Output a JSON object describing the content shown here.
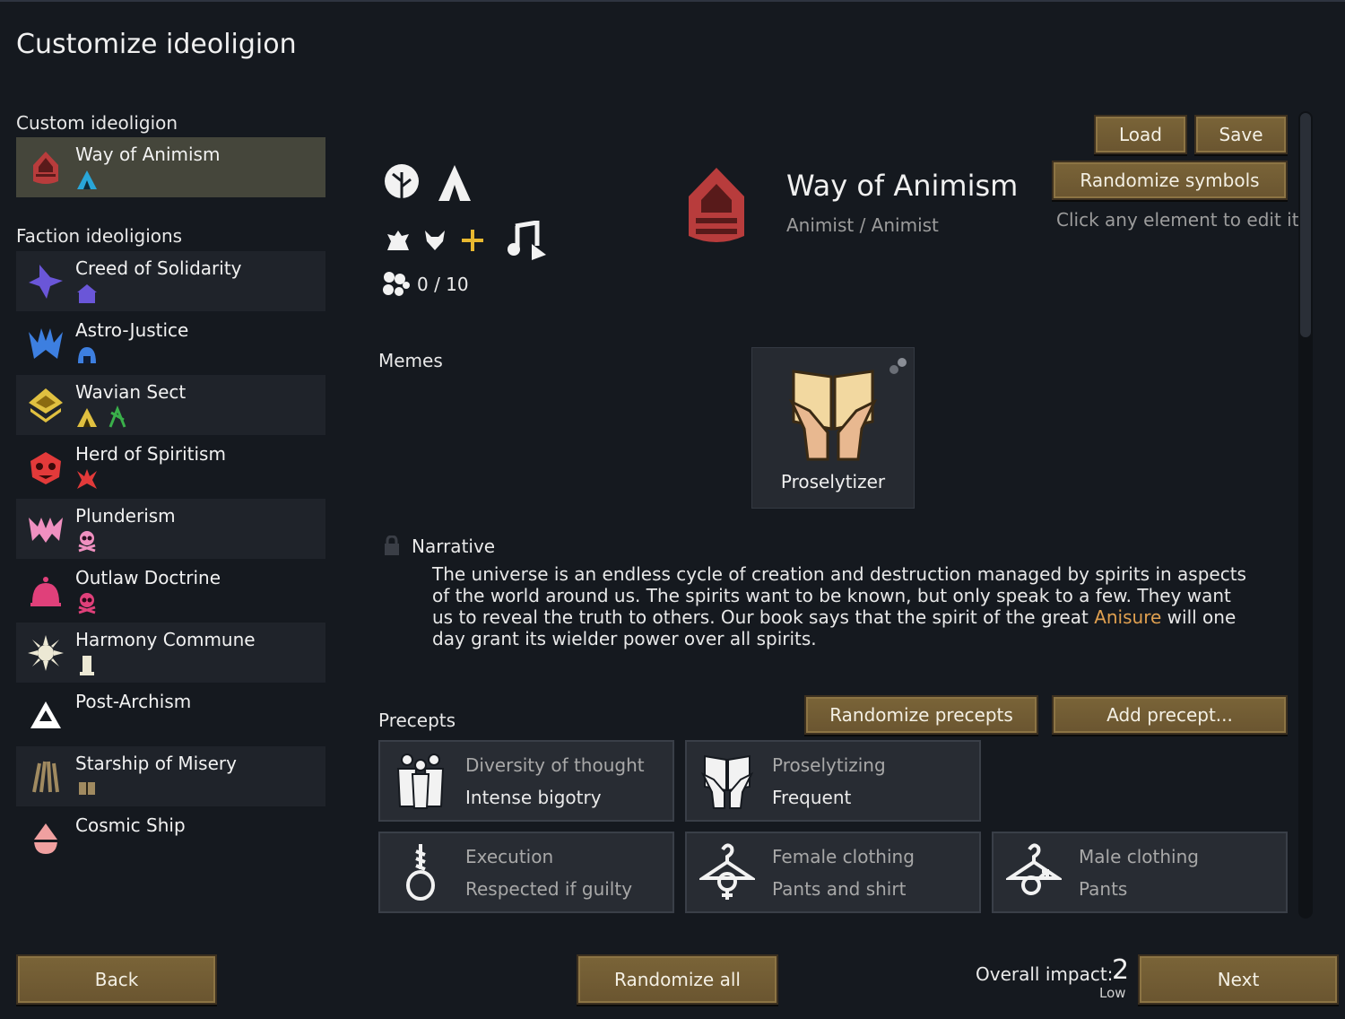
{
  "page": {
    "title": "Customize ideoligion"
  },
  "sidebar": {
    "custom_label": "Custom ideoligion",
    "custom": {
      "name": "Way of Animism",
      "icon": "flame-shrine-icon"
    },
    "faction_label": "Faction ideoligions",
    "factions": [
      {
        "name": "Creed of Solidarity",
        "icon": "star-burst-icon"
      },
      {
        "name": "Astro-Justice",
        "icon": "crown-spike-icon"
      },
      {
        "name": "Wavian Sect",
        "icon": "chevron-stack-icon"
      },
      {
        "name": "Herd of Spiritism",
        "icon": "demon-face-icon"
      },
      {
        "name": "Plunderism",
        "icon": "bat-wing-icon"
      },
      {
        "name": "Outlaw Doctrine",
        "icon": "dome-bell-icon"
      },
      {
        "name": "Harmony Commune",
        "icon": "sun-burst-icon"
      },
      {
        "name": "Post-Archism",
        "icon": "triangle-icon"
      },
      {
        "name": "Starship of Misery",
        "icon": "talon-icon"
      },
      {
        "name": "Cosmic Ship",
        "icon": "drop-icon"
      }
    ]
  },
  "header": {
    "name": "Way of Animism",
    "adjective": "Animist / Animist",
    "edit_hint": "Click any element to edit it",
    "load_label": "Load",
    "save_label": "Save",
    "randomize_symbols_label": "Randomize symbols",
    "count_text": "0 / 10"
  },
  "memes": {
    "label": "Memes",
    "items": [
      {
        "name": "Proselytizer",
        "icon": "open-book-hands-icon"
      }
    ]
  },
  "narrative": {
    "label": "Narrative",
    "text_before": "The universe is an endless cycle of creation and destruction managed by spirits in aspects of the world around us. The spirits want to be known, but only speak to a few. They want us to reveal the truth to others. Our book says that the spirit of the great ",
    "highlight": "Anisure",
    "text_after": " will one day grant its wielder power over all spirits."
  },
  "precepts": {
    "label": "Precepts",
    "randomize_label": "Randomize precepts",
    "add_label": "Add precept...",
    "items": [
      {
        "title": "Diversity of thought",
        "value": "Intense bigotry",
        "icon": "people-group-icon"
      },
      {
        "title": "Proselytizing",
        "value": "Frequent",
        "icon": "book-hands-icon"
      },
      {
        "title": "Execution",
        "value": "Respected if guilty",
        "icon": "noose-icon"
      },
      {
        "title": "Female clothing",
        "value": "Pants and shirt",
        "icon": "hanger-female-icon"
      },
      {
        "title": "Male clothing",
        "value": "Pants",
        "icon": "hanger-male-icon"
      }
    ]
  },
  "footer": {
    "back_label": "Back",
    "randomize_all_label": "Randomize all",
    "next_label": "Next",
    "impact_label": "Overall impact:",
    "impact_value": "2",
    "impact_level": "Low"
  },
  "colors": {
    "background": "#15191f",
    "button": "#7a6438",
    "selected_row": "#45463b",
    "highlight": "#e0a050",
    "ideo_icon": "#b83c3c"
  }
}
